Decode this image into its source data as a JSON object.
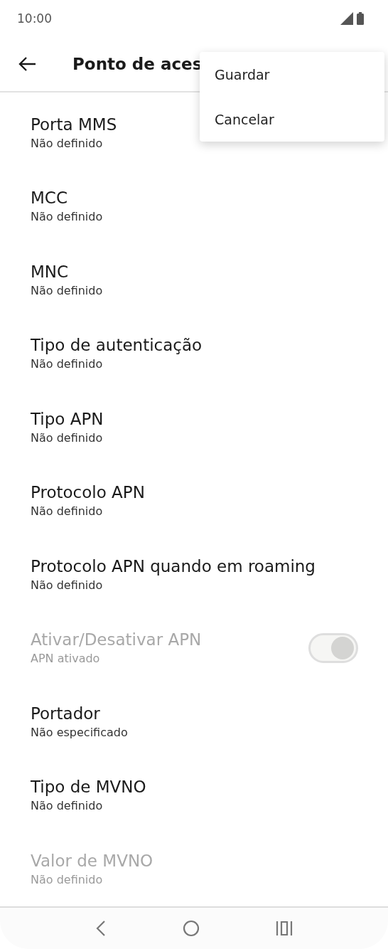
{
  "status_bar": {
    "time": "10:00"
  },
  "header": {
    "title": "Ponto de aces"
  },
  "menu": {
    "items": [
      {
        "label": "Guardar"
      },
      {
        "label": "Cancelar"
      }
    ]
  },
  "settings": [
    {
      "kind": "setting",
      "title": "Porta MMS",
      "summary": "Não definido",
      "disabled": false
    },
    {
      "kind": "setting",
      "title": "MCC",
      "summary": "Não definido",
      "disabled": false
    },
    {
      "kind": "setting",
      "title": "MNC",
      "summary": "Não definido",
      "disabled": false
    },
    {
      "kind": "setting",
      "title": "Tipo de autenticação",
      "summary": "Não definido",
      "disabled": false
    },
    {
      "kind": "setting",
      "title": "Tipo APN",
      "summary": "Não definido",
      "disabled": false
    },
    {
      "kind": "setting",
      "title": "Protocolo APN",
      "summary": "Não definido",
      "disabled": false
    },
    {
      "kind": "setting",
      "title": "Protocolo APN quando em roaming",
      "summary": "Não definido",
      "disabled": false
    },
    {
      "kind": "toggle",
      "title": "Ativar/Desativar APN",
      "summary": "APN ativado",
      "disabled": true,
      "on": true
    },
    {
      "kind": "setting",
      "title": "Portador",
      "summary": "Não especificado",
      "disabled": false
    },
    {
      "kind": "setting",
      "title": "Tipo de MVNO",
      "summary": "Não definido",
      "disabled": false
    },
    {
      "kind": "setting",
      "title": "Valor de MVNO",
      "summary": "Não definido",
      "disabled": true
    }
  ]
}
